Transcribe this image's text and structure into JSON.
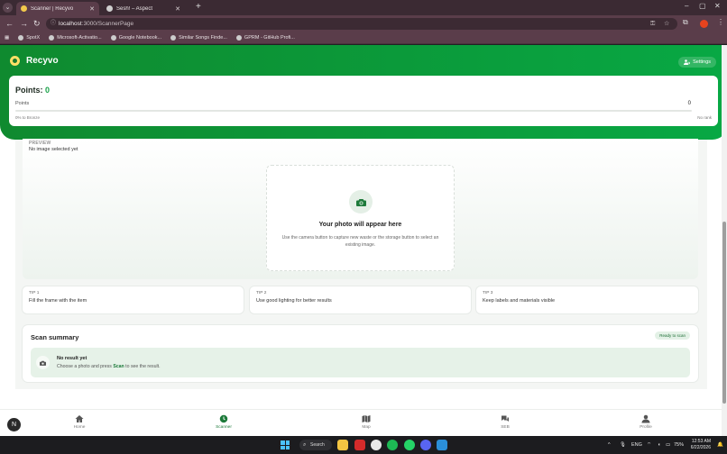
{
  "browser": {
    "tabs": [
      {
        "title": "Scanner | Recyvo",
        "active": true
      },
      {
        "title": "Sesh! – Aspect",
        "active": false
      }
    ],
    "url_host": "localhost",
    "url_path": ":3000/ScannerPage",
    "bookmarks": [
      "SpotX",
      "Microsoft-Activatio...",
      "Google Notebook...",
      "Similar Songs Finde...",
      "GPRM - GitHub Profi..."
    ]
  },
  "app": {
    "brand": "Recyvo",
    "settings_label": "Settings",
    "points": {
      "title": "Points:",
      "value": "0",
      "row_label": "Points",
      "row_value": "0",
      "progress_fraction": 0.0,
      "foot_left": "0% to Bronze",
      "foot_right": "No rank"
    },
    "preview": {
      "label": "PREVIEW",
      "sub": "No image selected yet",
      "box_title": "Your photo will appear here",
      "box_desc": "Use the camera button to capture new waste or the storage button to select an existing image."
    },
    "tips": [
      {
        "label": "TIP 1",
        "text": "Fill the frame with the item"
      },
      {
        "label": "TIP 2",
        "text": "Use good lighting for better results"
      },
      {
        "label": "TIP 3",
        "text": "Keep labels and materials visible"
      }
    ],
    "summary": {
      "title": "Scan summary",
      "badge": "Ready to scan",
      "result_title": "No result yet",
      "result_prefix": "Choose a photo and press",
      "result_keyword": "Scan",
      "result_suffix": "to see the result."
    },
    "nav": [
      {
        "label": "Home",
        "icon": "home-icon",
        "active": false
      },
      {
        "label": "Scanner",
        "icon": "scanner-icon",
        "active": true
      },
      {
        "label": "Map",
        "icon": "map-icon",
        "active": false
      },
      {
        "label": "SEB",
        "icon": "chat-icon",
        "active": false
      },
      {
        "label": "Profile",
        "icon": "profile-icon",
        "active": false
      }
    ],
    "colors": {
      "primary": "#0b9a3a",
      "accent_text": "#1d7a3a",
      "soft_green": "#e6f2e8"
    }
  },
  "taskbar": {
    "search_label": "Search",
    "language": "ENG",
    "battery": "75%",
    "time": "12:53 AM",
    "date": "6/22/2026"
  }
}
